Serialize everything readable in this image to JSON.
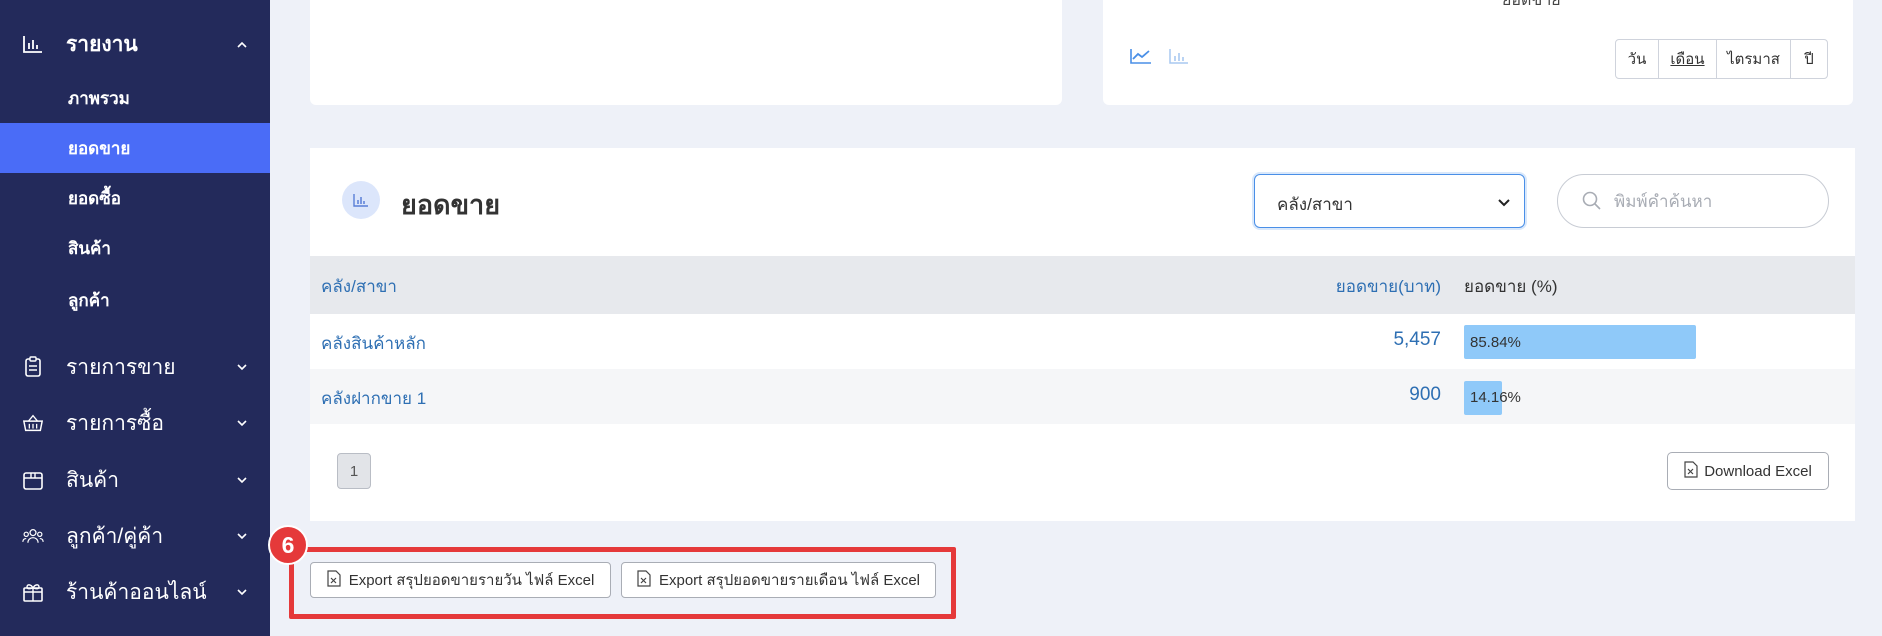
{
  "sidebar": {
    "report": {
      "label": "รายงาน",
      "icon": "bar-chart-icon"
    },
    "children": [
      {
        "label": "ภาพรวม",
        "active": false
      },
      {
        "label": "ยอดขาย",
        "active": true
      },
      {
        "label": "ยอดซื้อ",
        "active": false
      },
      {
        "label": "สินค้า",
        "active": false
      },
      {
        "label": "ลูกค้า",
        "active": false
      }
    ],
    "items": [
      {
        "label": "รายการขาย",
        "icon": "clipboard-icon"
      },
      {
        "label": "รายการซื้อ",
        "icon": "basket-icon"
      },
      {
        "label": "สินค้า",
        "icon": "box-icon"
      },
      {
        "label": "ลูกค้า/คู่ค้า",
        "icon": "users-icon"
      },
      {
        "label": "ร้านค้าออนไลน์",
        "icon": "gift-icon"
      }
    ]
  },
  "top_chart": {
    "cut_text": "ยอดขาย",
    "icons": [
      "line-chart-icon",
      "bar-chart-icon"
    ],
    "periods": [
      "วัน",
      "เดือน",
      "ไตรมาส",
      "ปี"
    ],
    "selected_period": "เดือน"
  },
  "sales": {
    "title": "ยอดขาย",
    "filter_value": "คลัง/สาขา",
    "search_placeholder": "พิมพ์คำค้นหา",
    "columns": {
      "branch": "คลัง/สาขา",
      "amount": "ยอดขาย(บาท)",
      "percent": "ยอดขาย (%)"
    },
    "rows": [
      {
        "branch": "คลังสินค้าหลัก",
        "amount": "5,457",
        "percent": "85.84%",
        "share": 0.8584
      },
      {
        "branch": "คลังฝากขาย 1",
        "amount": "900",
        "percent": "14.16%",
        "share": 0.1416
      }
    ],
    "page": "1",
    "download_label": "Download Excel"
  },
  "exports": {
    "badge": "6",
    "daily_label": "Export สรุปยอดขายรายวัน ไฟล์ Excel",
    "monthly_label": "Export สรุปยอดขายรายเดือน ไฟล์ Excel"
  },
  "colors": {
    "sidebar": "#232a5b",
    "active": "#4a6cf7",
    "link": "#2e6fb3",
    "bar": "#8fc9f9",
    "highlight": "#e5393a"
  }
}
